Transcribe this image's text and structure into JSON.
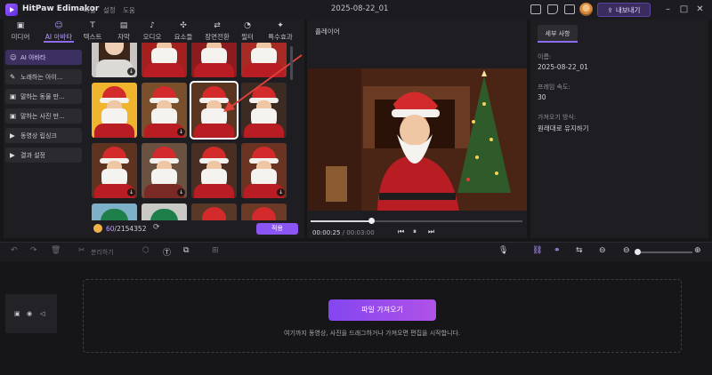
{
  "titlebar": {
    "app_title": "HitPaw Edimakor",
    "menu": [
      "파일",
      "설정",
      "도움"
    ],
    "project_name": "2025-08-22_01",
    "export_label": "내보내기"
  },
  "tabs": [
    {
      "icon": "▣",
      "label": "미디어"
    },
    {
      "icon": "☺",
      "label": "AI 아바타"
    },
    {
      "icon": "T",
      "label": "텍스트"
    },
    {
      "icon": "▤",
      "label": "자막"
    },
    {
      "icon": "♪",
      "label": "오디오"
    },
    {
      "icon": "✣",
      "label": "요소들"
    },
    {
      "icon": "⇄",
      "label": "장면전환"
    },
    {
      "icon": "◔",
      "label": "필터"
    },
    {
      "icon": "✦",
      "label": "특수효과"
    }
  ],
  "sidebar": [
    {
      "icon": "☺",
      "label": "AI 아바타"
    },
    {
      "icon": "✎",
      "label": "노래하는 아이..."
    },
    {
      "icon": "▣",
      "label": "말하는 동물 만..."
    },
    {
      "icon": "▣",
      "label": "말하는 사진 만..."
    },
    {
      "icon": "▶",
      "label": "동영상 립싱크"
    },
    {
      "icon": "▶",
      "label": "결과 설정"
    }
  ],
  "credits": {
    "used": "60",
    "total": "/2154352"
  },
  "apply_label": "적용",
  "player": {
    "label": "플레이어",
    "current_time": "00:00:25",
    "total_time": "/ 00:03:00"
  },
  "details": {
    "tab_label": "세부 사항",
    "name_label": "이름:",
    "name_value": "2025-08-22_01",
    "fps_label": "프레임 속도:",
    "fps_value": "30",
    "import_mode_label": "가져오기 방식:",
    "import_mode_value": "원래대로 유지하기"
  },
  "toolbar": {
    "speed_label": "분리하기"
  },
  "timeline": {
    "import_button": "파일 가져오기",
    "hint": "여기까지 동영상, 사진을 드래그하거나 가져오면 편집을 시작합니다."
  },
  "colors": {
    "accent": "#8e6cf0",
    "apply": "#8a55f2",
    "background": "#161618"
  }
}
